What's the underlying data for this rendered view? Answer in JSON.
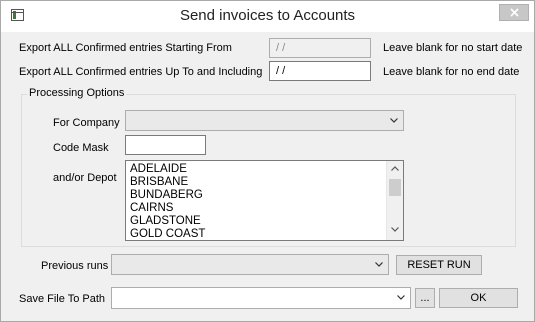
{
  "window": {
    "title": "Send invoices to Accounts"
  },
  "export_from": {
    "label": "Export ALL Confirmed entries Starting From",
    "value": "/ /",
    "hint": "Leave blank for no start date"
  },
  "export_to": {
    "label": "Export ALL Confirmed entries Up To and Including",
    "value": "/ /",
    "hint": "Leave blank for no end date"
  },
  "processing": {
    "group_title": "Processing Options",
    "company_label": "For Company",
    "company_value": "",
    "code_mask_label": "Code Mask",
    "code_mask_value": "",
    "depot_label": "and/or Depot",
    "depots": [
      "ADELAIDE",
      "BRISBANE",
      "BUNDABERG",
      "CAIRNS",
      "GLADSTONE",
      "GOLD COAST"
    ]
  },
  "previous_runs": {
    "label": "Previous runs",
    "value": "",
    "reset_label": "RESET RUN"
  },
  "save_path": {
    "label": "Save File To Path",
    "value": "",
    "browse_label": "...",
    "ok_label": "OK"
  },
  "icons": {
    "app": "app-window-icon",
    "close": "close-icon",
    "dropdown": "chevron-down-icon"
  }
}
